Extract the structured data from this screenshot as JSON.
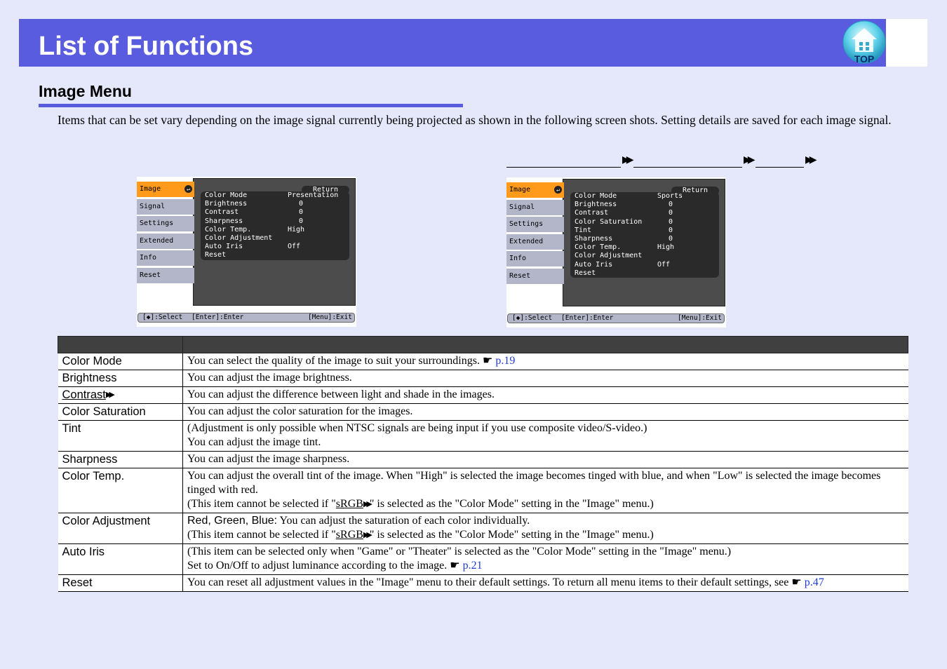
{
  "header": {
    "title": "List of Functions",
    "top_label": "TOP"
  },
  "section": {
    "title": "Image Menu",
    "intro": "Items that can be set vary depending on the image signal currently being projected as shown in the following screen shots. Setting details are saved for each image signal."
  },
  "screen_left": {
    "sidebar": [
      "Image",
      "Signal",
      "Settings",
      "Extended",
      "Info",
      "Reset"
    ],
    "return_label": "Return",
    "rows": [
      {
        "label": "Color Mode",
        "value": "Presentation"
      },
      {
        "label": "Brightness",
        "value": "0"
      },
      {
        "label": "Contrast",
        "value": "0"
      },
      {
        "label": "Sharpness",
        "value": "0"
      },
      {
        "label": "Color Temp.",
        "value": "High"
      },
      {
        "label": "Color Adjustment",
        "value": ""
      },
      {
        "label": "Auto Iris",
        "value": "Off"
      },
      {
        "label": "Reset",
        "value": ""
      }
    ],
    "footer": {
      "select": "[◆]:Select",
      "enter": "[Enter]:Enter",
      "exit": "[Menu]:Exit"
    }
  },
  "screen_right": {
    "sidebar": [
      "Image",
      "Signal",
      "Settings",
      "Extended",
      "Info",
      "Reset"
    ],
    "return_label": "Return",
    "rows": [
      {
        "label": "Color Mode",
        "value": "Sports"
      },
      {
        "label": "Brightness",
        "value": "0"
      },
      {
        "label": "Contrast",
        "value": "0"
      },
      {
        "label": "Color Saturation",
        "value": "0"
      },
      {
        "label": "Tint",
        "value": "0"
      },
      {
        "label": "Sharpness",
        "value": "0"
      },
      {
        "label": "Color Temp.",
        "value": "High"
      },
      {
        "label": "Color Adjustment",
        "value": ""
      },
      {
        "label": "Auto Iris",
        "value": "Off"
      },
      {
        "label": "Reset",
        "value": ""
      }
    ],
    "footer": {
      "select": "[◆]:Select",
      "enter": "[Enter]:Enter",
      "exit": "[Menu]:Exit"
    }
  },
  "table": {
    "rows": [
      {
        "item": "Color Mode",
        "desc": "You can select the quality of the image to suit your surroundings.",
        "ref": "p.19"
      },
      {
        "item": "Brightness",
        "desc": "You can adjust the image brightness."
      },
      {
        "item": "Contrast",
        "desc": "You can adjust the difference between light and shade in the images."
      },
      {
        "item": "Color Saturation",
        "desc": "You can adjust the color saturation for the images."
      },
      {
        "item": "Tint",
        "desc1": "(Adjustment is only possible when NTSC signals are being input if you use composite video/S-video.)",
        "desc2": "You can adjust the image tint."
      },
      {
        "item": "Sharpness",
        "desc": "You can adjust the image sharpness."
      },
      {
        "item": "Color Temp.",
        "desc1": "You can adjust the overall tint of the image. When \"High\" is selected the image becomes tinged with blue, and when \"Low\" is selected the image becomes tinged with red.",
        "desc2_pre": "(This item cannot be selected if \"",
        "desc2_term": "sRGB",
        "desc2_post": "\" is selected as the \"Color Mode\" setting in the \"Image\" menu.)"
      },
      {
        "item": "Color Adjustment",
        "desc1_lead": "Red, Green, Blue:",
        "desc1": " You can adjust the saturation of each color individually.",
        "desc2_pre": "(This item cannot be selected if \"",
        "desc2_term": "sRGB",
        "desc2_post": "\" is selected as the \"Color Mode\" setting in the \"Image\" menu.)"
      },
      {
        "item": "Auto Iris",
        "desc1": "(This item can be selected only when \"Game\" or \"Theater\" is selected as the \"Color Mode\" setting in the \"Image\" menu.)",
        "desc2": "Set to On/Off to adjust luminance according to the image.",
        "ref": "p.21"
      },
      {
        "item": "Reset",
        "desc": "You can reset all adjustment values in the \"Image\" menu to their default settings. To return all menu items to their default settings, see",
        "ref": "p.47"
      }
    ]
  }
}
